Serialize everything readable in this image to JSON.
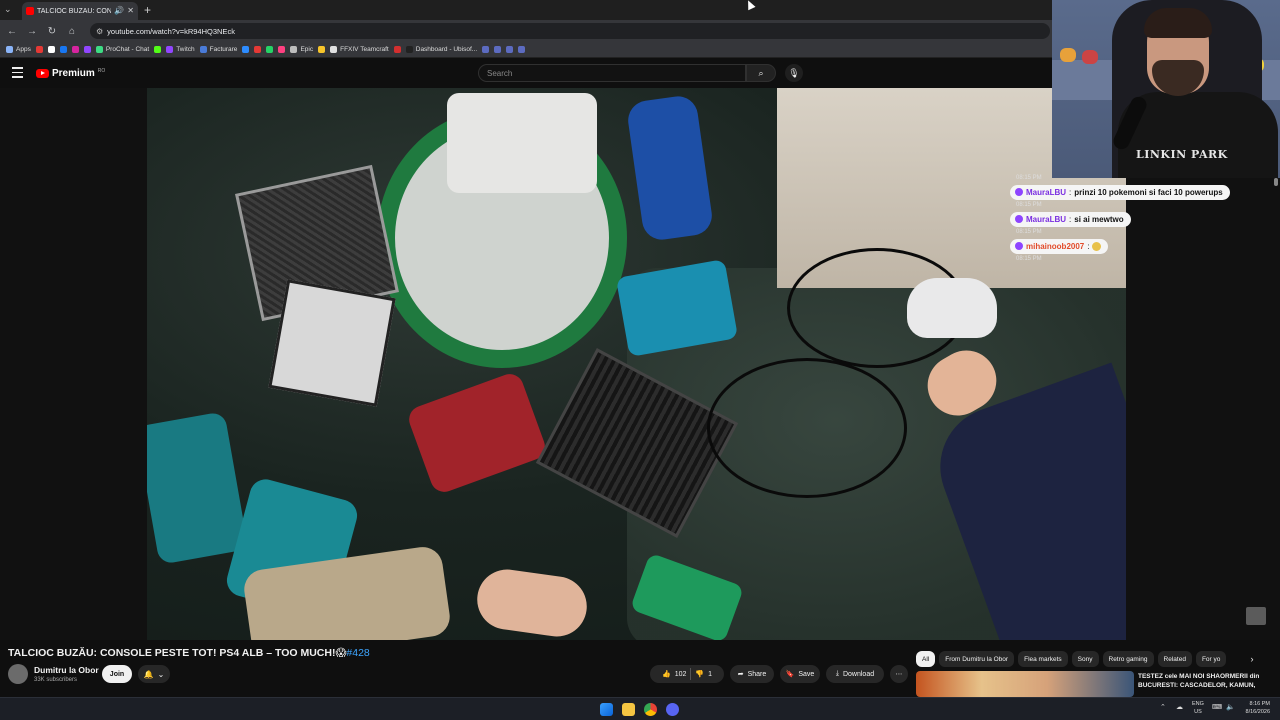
{
  "browser": {
    "tab_title": "TALCIOC BUZĂU: CONSOLE",
    "url": "youtube.com/watch?v=kR94HQ3NEck",
    "new_tab": "+",
    "bookmarks": [
      {
        "label": "Apps",
        "color": "#8ab4f8"
      },
      {
        "label": "",
        "color": "#e53935"
      },
      {
        "label": "",
        "color": "#ffffff"
      },
      {
        "label": "",
        "color": "#1877f2"
      },
      {
        "label": "",
        "color": "#d6249f"
      },
      {
        "label": "",
        "color": "#9146ff"
      },
      {
        "label": "ProChat - Chat",
        "color": "#3ddc84"
      },
      {
        "label": "",
        "color": "#53fc18"
      },
      {
        "label": "Twitch",
        "color": "#9146ff"
      },
      {
        "label": "Facturare",
        "color": "#4a7bd8"
      },
      {
        "label": "",
        "color": "#2d8cff"
      },
      {
        "label": "",
        "color": "#e53935"
      },
      {
        "label": "",
        "color": "#25d366"
      },
      {
        "label": "",
        "color": "#ff4081"
      },
      {
        "label": "Epic",
        "color": "#bdbdbd"
      },
      {
        "label": "",
        "color": "#f7c52b"
      },
      {
        "label": "FFXIV Teamcraft",
        "color": "#e0e0e0"
      },
      {
        "label": "",
        "color": "#d32f2f"
      },
      {
        "label": "Dashboard - Ubisof...",
        "color": "#212121"
      },
      {
        "label": "",
        "color": "#5c6bc0"
      },
      {
        "label": "",
        "color": "#5c6bc0"
      },
      {
        "label": "",
        "color": "#5c6bc0"
      },
      {
        "label": "",
        "color": "#5c6bc0"
      }
    ]
  },
  "youtube": {
    "logo_text": "Premium",
    "logo_sup": "RO",
    "search_placeholder": "Search"
  },
  "webcam": {
    "shirt_text": "LINKIN PARK"
  },
  "chat": [
    {
      "time": "08:15 PM",
      "user": "MauraLBU",
      "text": "prinzi 10 pokemoni si faci 10 powerups",
      "user_color": "#7a2ee0"
    },
    {
      "time": "08:15 PM",
      "user": "MauraLBU",
      "text": "si ai mewtwo",
      "user_color": "#7a2ee0"
    },
    {
      "time": "08:15 PM",
      "user": "mihainoob2007",
      "text": "",
      "user_color": "#e24b2a",
      "emote": "laugh-emote"
    },
    {
      "time": "08:15 PM"
    }
  ],
  "video": {
    "title": "TALCIOC BUZĂU: CONSOLE PESTE TOT! PS4 ALB – TOO MUCH!😱",
    "hashtag": "#428",
    "channel": "Dumitru la Obor",
    "subscribers": "33K subscribers",
    "join_label": "Join",
    "like_count": "102",
    "dislike_count": "1",
    "share_label": "Share",
    "save_label": "Save",
    "download_label": "Download"
  },
  "sidebar": {
    "chips": [
      "All",
      "From Dumitru la Obor",
      "Flea markets",
      "Sony",
      "Retro gaming",
      "Related",
      "For yo"
    ],
    "active_chip": "All",
    "rec_title": "TESTEZ cele MAI NOI SHAORMERII din BUCURESTI: CASCADELOR, KAMUN,"
  },
  "taskbar": {
    "lang_line1": "ENG",
    "lang_line2": "US",
    "time": "8:16 PM",
    "date": "8/16/2026"
  }
}
